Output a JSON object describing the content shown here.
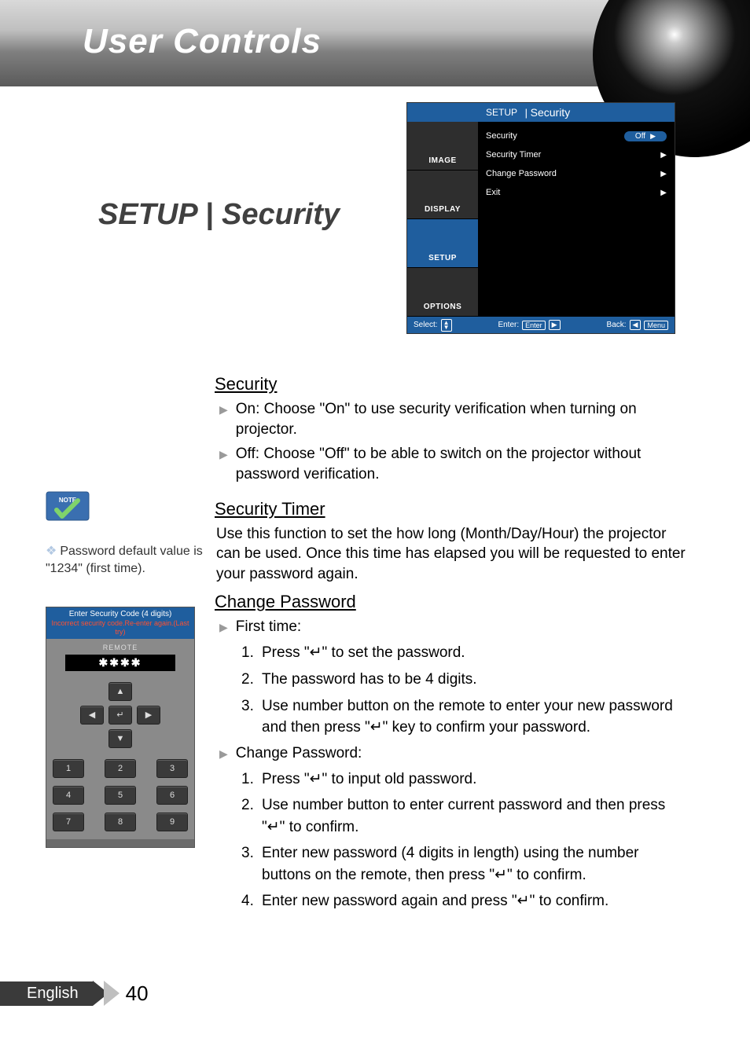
{
  "header": {
    "title": "User Controls"
  },
  "section_heading": "SETUP | Security",
  "osd": {
    "breadcrumb1": "SETUP",
    "breadcrumb2": "Security",
    "tabs": [
      "IMAGE",
      "DISPLAY",
      "SETUP",
      "OPTIONS"
    ],
    "active_tab_index": 2,
    "rows": [
      {
        "label": "Security",
        "value": "Off",
        "type": "toggle"
      },
      {
        "label": "Security Timer",
        "type": "submenu"
      },
      {
        "label": "Change Password",
        "type": "submenu"
      },
      {
        "label": "Exit",
        "type": "submenu"
      }
    ],
    "footer": {
      "select_label": "Select:",
      "enter_label": "Enter:",
      "enter_key": "Enter",
      "back_label": "Back:",
      "back_key": "Menu"
    }
  },
  "body": {
    "security_heading": "Security",
    "security_on": "On: Choose \"On\" to use security verification when turning on projector.",
    "security_off": "Off: Choose \"Off\" to be able to switch on the projector without password verification.",
    "timer_heading": "Security Timer",
    "timer_text": "Use this function to set the how long (Month/Day/Hour) the projector can be used. Once this time has elapsed you will be requested to enter your password again.",
    "change_heading": "Change Password",
    "first_time_label": "First time:",
    "first_steps": [
      "Press \"↵\" to set the password.",
      "The password has to be 4 digits.",
      "Use number button on the remote to enter your new password and then press \"↵\" key to confirm your password."
    ],
    "change_label": "Change Password:",
    "change_steps": [
      "Press \"↵\" to input old password.",
      "Use number button to enter current password and then press \"↵\" to confirm.",
      "Enter new password (4 digits in length) using the number buttons on the remote, then press \"↵\" to confirm.",
      "Enter new password again and press \"↵\" to confirm."
    ]
  },
  "side_note": {
    "badge_label": "NOTE",
    "text": "Password default value is \"1234\" (first time)."
  },
  "keypad": {
    "line1": "Enter Security Code (4 digits)",
    "line2": "Incorrect security code.Re-enter again.(Last try)",
    "remote_label": "REMOTE",
    "stars": "✱✱✱✱",
    "dpad": {
      "up": "▲",
      "down": "▼",
      "left": "◀",
      "right": "▶",
      "enter": "↵"
    },
    "numbers": [
      "1",
      "2",
      "3",
      "4",
      "5",
      "6",
      "7",
      "8",
      "9"
    ]
  },
  "footer": {
    "language": "English",
    "page": "40"
  }
}
